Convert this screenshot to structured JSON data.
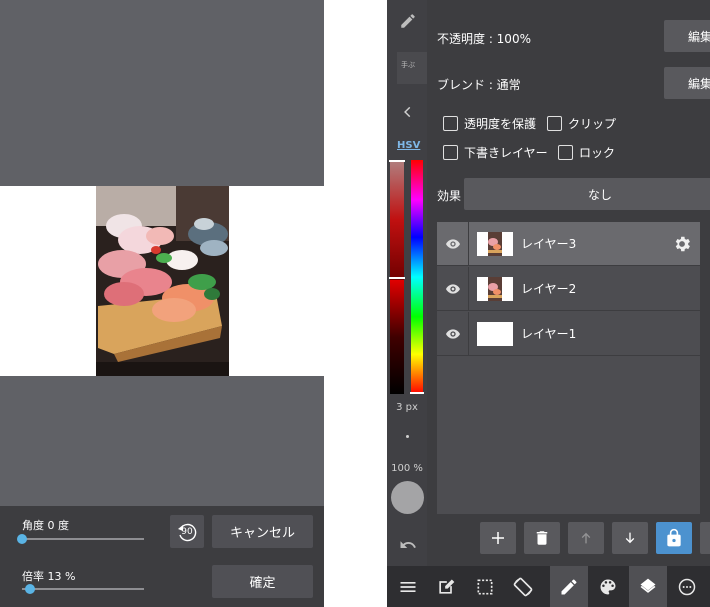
{
  "transform": {
    "angle_label": "角度 0 度",
    "angle_value": 0,
    "scale_label": "倍率 13 %",
    "scale_value": 13,
    "rotate90_label": "90",
    "cancel_label": "キャンセル",
    "confirm_label": "確定"
  },
  "tools": {
    "hsv_label": "HSV",
    "brush_size": "3 px",
    "brush_opacity": "100 %",
    "current_color": "#a4a4a6"
  },
  "layer_props": {
    "opacity_label": "不透明度 : 100%",
    "blend_label": "ブレンド : 通常",
    "edit_label": "編集",
    "protect_alpha_label": "透明度を保護",
    "clip_label": "クリップ",
    "draft_label": "下書きレイヤー",
    "lock_label": "ロック",
    "effect_label": "効果",
    "effect_value": "なし"
  },
  "layers": [
    {
      "name": "レイヤー3",
      "selected": true,
      "thumbnail": "photo"
    },
    {
      "name": "レイヤー2",
      "selected": false,
      "thumbnail": "photo"
    },
    {
      "name": "レイヤー1",
      "selected": false,
      "thumbnail": "blank"
    }
  ],
  "layer_actions": [
    "plus-icon",
    "trash-icon",
    "arrow-up-icon",
    "arrow-down-icon",
    "lock-icon",
    "more-vertical-icon"
  ],
  "bottom_toolbar": [
    "menu-icon",
    "edit-icon",
    "selection-icon",
    "rotate-icon",
    "brush-icon",
    "palette-icon",
    "layers-icon",
    "dots-circle-icon"
  ],
  "colors": {
    "accent": "#4c92cf",
    "slider_knob": "#5ab4e5",
    "canvas_background": "#606166"
  }
}
